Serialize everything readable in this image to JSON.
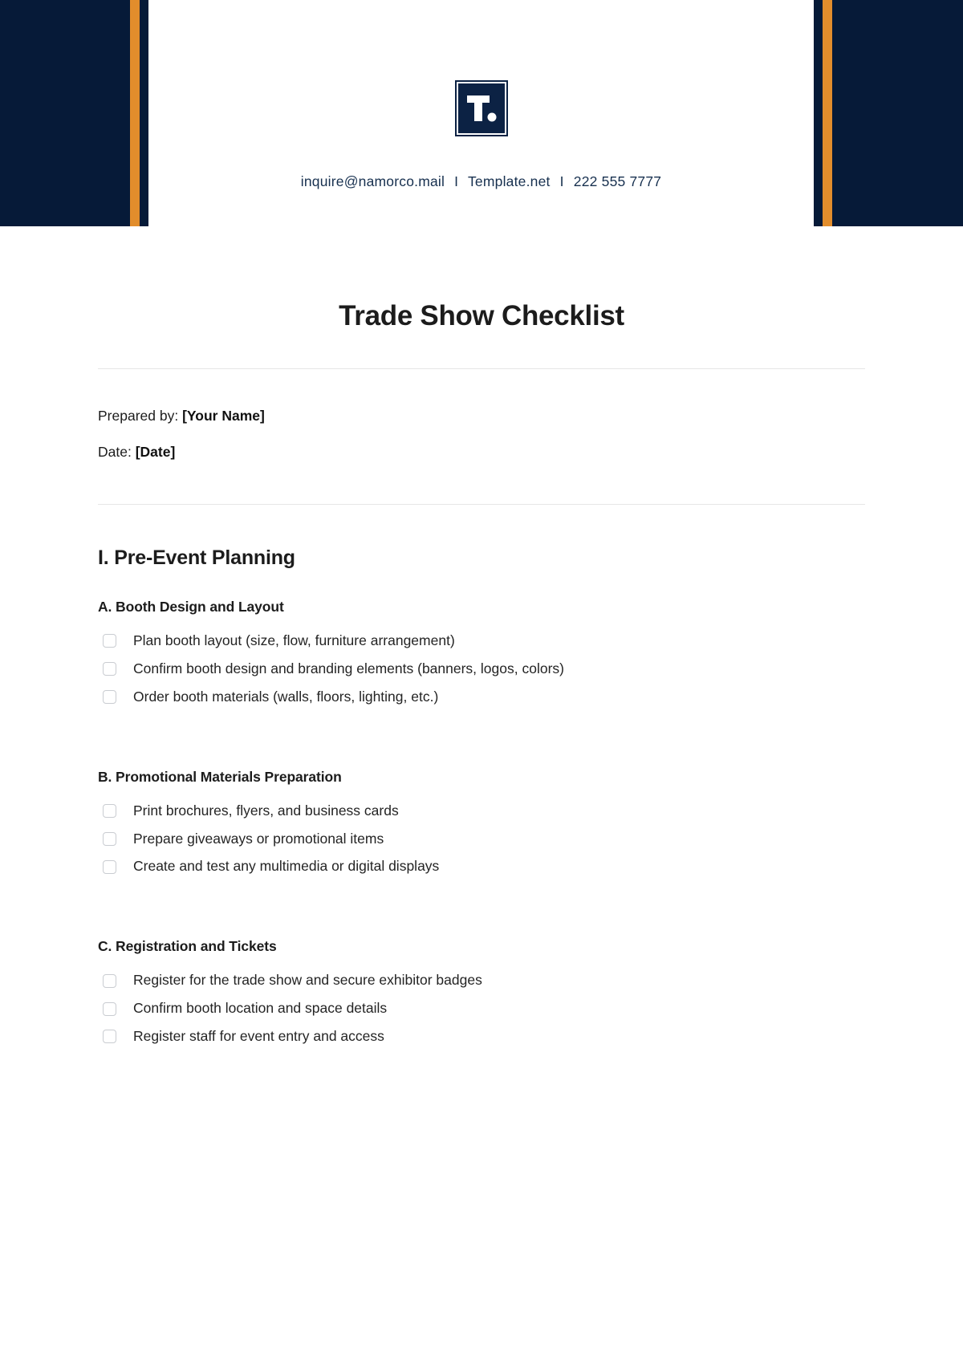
{
  "header": {
    "logo": {
      "icon": "letter-t-period-logo",
      "text": "T."
    },
    "contact": {
      "email": "inquire@namorco.mail",
      "website": "Template.net",
      "phone": "222 555 7777",
      "separator": "I"
    },
    "colors": {
      "navy": "#061A38",
      "orange": "#E28D2C",
      "logo_navy": "#0C2244",
      "contact_text": "#17304F"
    }
  },
  "document": {
    "title": "Trade Show Checklist",
    "meta": [
      {
        "label": "Prepared by:",
        "value": "[Your Name]"
      },
      {
        "label": "Date:",
        "value": "[Date]"
      }
    ],
    "sections": [
      {
        "title": "I. Pre-Event Planning",
        "subsections": [
          {
            "title": "A. Booth Design and Layout",
            "items": [
              "Plan booth layout (size, flow, furniture arrangement)",
              "Confirm booth design and branding elements (banners, logos, colors)",
              "Order booth materials (walls, floors, lighting, etc.)"
            ]
          },
          {
            "title": "B. Promotional Materials Preparation",
            "items": [
              "Print brochures, flyers, and business cards",
              "Prepare giveaways or promotional items",
              "Create and test any multimedia or digital displays"
            ]
          },
          {
            "title": "C. Registration and Tickets",
            "items": [
              "Register for the trade show and secure exhibitor badges",
              "Confirm booth location and space details",
              "Register staff for event entry and access"
            ]
          }
        ]
      }
    ]
  }
}
